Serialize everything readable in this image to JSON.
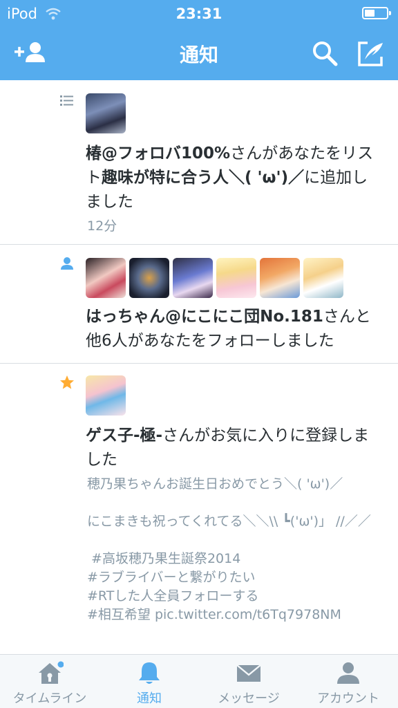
{
  "status_bar": {
    "carrier": "iPod",
    "time": "23:31",
    "battery": 0.4
  },
  "nav": {
    "title": "通知"
  },
  "notifications": [
    {
      "type": "list-added",
      "user": "椿@フォロバ100%",
      "text_mid": "さんがあなたをリスト",
      "list_name": "趣味が特に合う人＼( 'ω')／",
      "text_end": "に追加しました",
      "time": "12分"
    },
    {
      "type": "follow",
      "user": "はっちゃん@にこにこ団No.181",
      "text": "さんと他6人があなたをフォローしました"
    },
    {
      "type": "favorite",
      "user": "ゲス子-極-",
      "text": "さんがお気に入りに登録しました",
      "tweet": "穂乃果ちゃんお誕生日おめでとう＼( 'ω')／\n\nにこまきも祝ってくれてる＼＼\\\\ ┗('ω')」 //／／\n\n #高坂穂乃果生誕祭2014\n#ラブライバーと繋がりたい\n#RTした人全員フォローする\n#相互希望 pic.twitter.com/t6Tq7978NM"
    }
  ],
  "tabs": [
    {
      "label": "タイムライン",
      "icon": "home-icon"
    },
    {
      "label": "通知",
      "icon": "bell-icon",
      "active": true
    },
    {
      "label": "メッセージ",
      "icon": "envelope-icon"
    },
    {
      "label": "アカウント",
      "icon": "person-icon"
    }
  ],
  "colors": {
    "accent": "#55acee",
    "star": "#ffac33",
    "muted": "#8899a6",
    "text": "#292f33"
  }
}
